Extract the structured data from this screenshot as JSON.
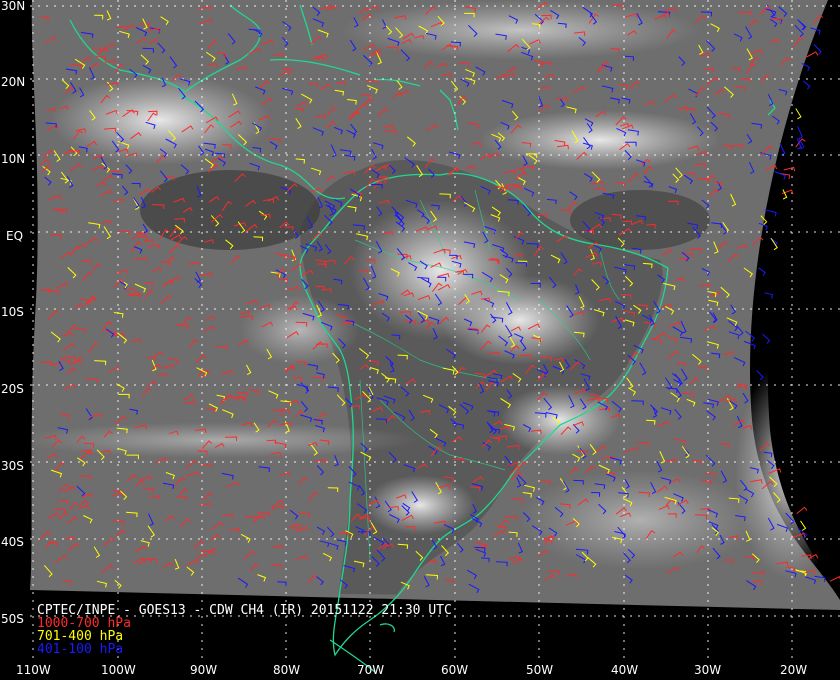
{
  "title": "CPTEC/INPE - GOES13 - CDW CH4 (IR) 20151122 21:30 UTC",
  "legend": [
    {
      "label": "1000-700 hPa",
      "color": "#ff2a2a"
    },
    {
      "label": "701-400 hPa",
      "color": "#ffff00"
    },
    {
      "label": "401-100 hPa",
      "color": "#1a1aff"
    }
  ],
  "lat_labels": [
    "30N",
    "20N",
    "10N",
    "EQ",
    "10S",
    "20S",
    "30S",
    "40S",
    "50S"
  ],
  "lon_labels": [
    "110W",
    "100W",
    "90W",
    "80W",
    "70W",
    "60W",
    "50W",
    "40W",
    "30W",
    "20W"
  ],
  "colors": {
    "coastline": "#20d890",
    "grid": "#ffffff",
    "background": "#000000"
  }
}
